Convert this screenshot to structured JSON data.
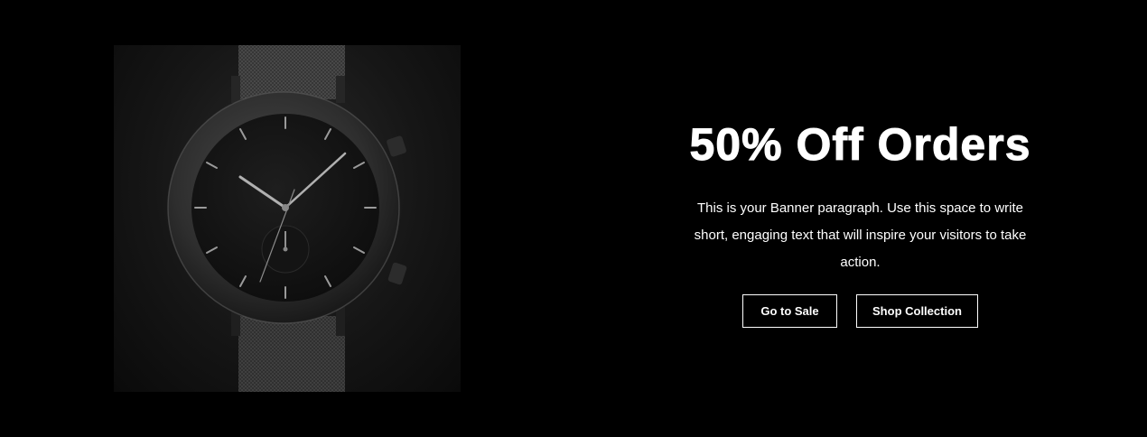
{
  "banner": {
    "background_color": "#000000",
    "image": {
      "subject_icon": "wristwatch-icon"
    },
    "headline": "50% Off Orders",
    "paragraph": "This is your Banner paragraph. Use this space to write short, engaging text that will inspire your visitors to take action.",
    "buttons": [
      {
        "label": "Go to Sale"
      },
      {
        "label": "Shop Collection"
      }
    ],
    "text_color": "#ffffff",
    "button_border_color": "#ffffff"
  }
}
